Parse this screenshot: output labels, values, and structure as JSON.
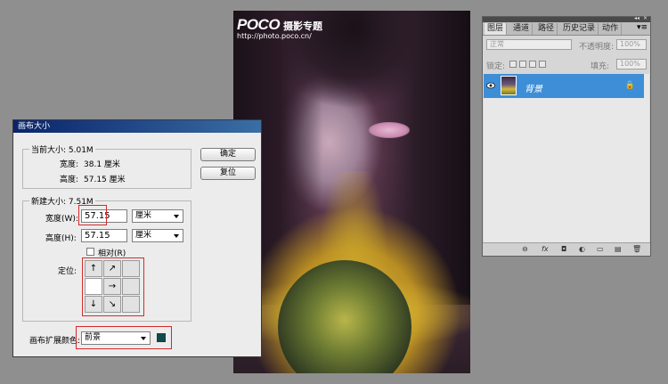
{
  "watermark": {
    "logo": "POCO",
    "title": "摄影专题",
    "url": "http://photo.poco.cn/"
  },
  "dialog": {
    "title": "画布大小",
    "current_group_label": "当前大小: 5.01M",
    "current_width_label": "宽度:",
    "current_width_value": "38.1 厘米",
    "current_height_label": "高度:",
    "current_height_value": "57.15 厘米",
    "new_group_label": "新建大小: 7.51M",
    "width_label": "宽度(W):",
    "width_value": "57.15",
    "width_unit": "厘米",
    "height_label": "高度(H):",
    "height_value": "57.15",
    "height_unit": "厘米",
    "relative_label": "相对(R)",
    "anchor_label": "定位:",
    "anchor_arrows": [
      "↑",
      "↗",
      "",
      "",
      "→",
      "",
      "↓",
      "↘",
      ""
    ],
    "extension_color_label": "画布扩展颜色:",
    "extension_color_value": "前景",
    "extension_color_swatch": "#0f4a4f",
    "ok_button": "确定",
    "reset_button": "复位"
  },
  "layers_panel": {
    "collapse_glyph": "◂◂",
    "close_glyph": "✕",
    "menu_glyph": "▾≡",
    "tabs": [
      "图层",
      "通道",
      "路径",
      "历史记录",
      "动作"
    ],
    "active_tab": "图层",
    "blend_mode": "正常",
    "opacity_label": "不透明度:",
    "opacity_value": "100%",
    "lock_label": "锁定:",
    "fill_label": "填充:",
    "fill_value": "100%",
    "layer_name": "背景",
    "layer_lock_glyph": "🔒",
    "bottom_icons": [
      "⊖",
      "fx",
      "◘",
      "◐",
      "▭",
      "▤",
      "🗑"
    ]
  }
}
